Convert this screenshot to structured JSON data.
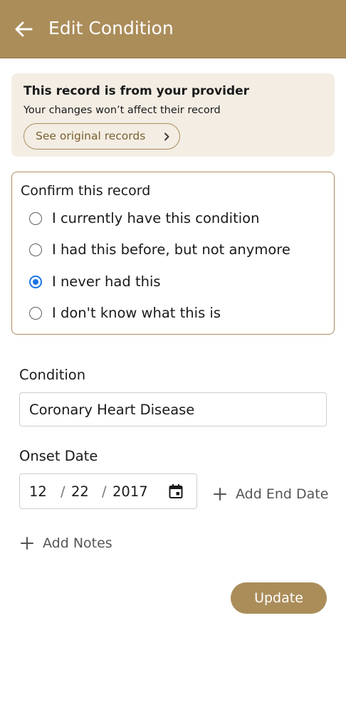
{
  "header": {
    "title": "Edit Condition",
    "bg_color": "#ab8d5a"
  },
  "provider_notice": {
    "title": "This record is from your provider",
    "subtitle": "Your changes won’t affect their record",
    "button_label": "See original records"
  },
  "confirm": {
    "title": "Confirm this record",
    "options": [
      {
        "label": "I currently have this condition",
        "checked": false
      },
      {
        "label": "I had this before, but not anymore",
        "checked": false
      },
      {
        "label": "I never had this",
        "checked": true
      },
      {
        "label": "I don't know what this is",
        "checked": false
      }
    ]
  },
  "condition": {
    "label": "Condition",
    "value": "Coronary Heart Disease"
  },
  "onset": {
    "label": "Onset Date",
    "month": "12",
    "day": "22",
    "year": "2017",
    "separator": "/",
    "add_end_date_label": "Add End Date"
  },
  "notes": {
    "add_label": "Add Notes"
  },
  "update_label": "Update",
  "icons": {
    "back": "arrow-left-icon",
    "chevron": "chevron-right-icon",
    "calendar": "calendar-icon",
    "plus": "plus-icon"
  },
  "colors": {
    "accent": "#ab8d5a",
    "card_bg": "#f3ede4",
    "radio_selected": "#1a73e8"
  }
}
